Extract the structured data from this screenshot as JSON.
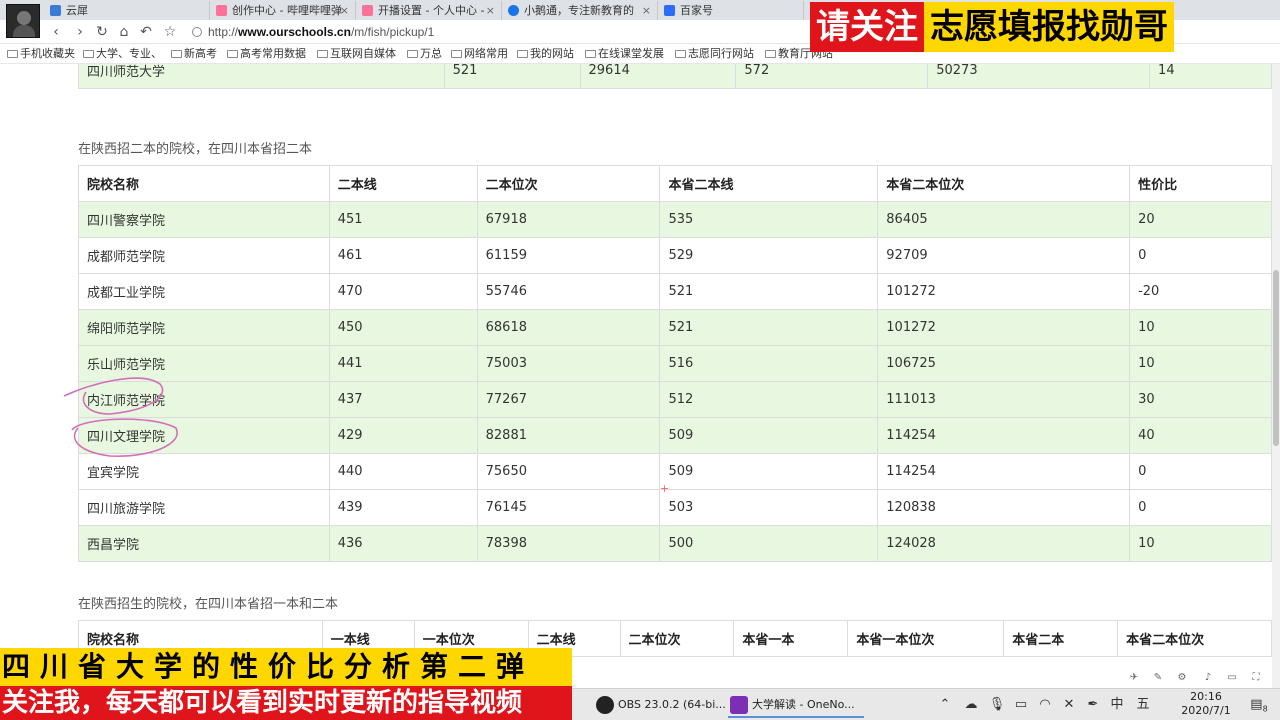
{
  "browser": {
    "tabs": [
      {
        "label": "云犀",
        "color": "#3a7bd5"
      },
      {
        "label": "创作中心 - 哔哩哔哩弹",
        "color": "#fb7299"
      },
      {
        "label": "开播设置 - 个人中心 -",
        "color": "#fb7299"
      },
      {
        "label": "小鹅通，专注新教育的",
        "color": "#1a73e8"
      },
      {
        "label": "百家号",
        "color": "#2d6cf5"
      }
    ],
    "address": {
      "prefix": "http://",
      "domain": "www.ourschools.cn",
      "path": "/m/fish/pickup/1"
    },
    "bookmarks": [
      "手机收藏夹",
      "大学、专业、",
      "新高考",
      "高考常用数据",
      "互联网自媒体",
      "万总",
      "网络常用",
      "我的网站",
      "在线课堂发展",
      "志愿同行网站",
      "教育厅网站"
    ]
  },
  "top_table_row": {
    "cells": [
      "四川师范大学",
      "521",
      "29614",
      "572",
      "50273",
      "14"
    ]
  },
  "section2": {
    "caption": "在陕西招二本的院校，在四川本省招二本",
    "headers": [
      "院校名称",
      "二本线",
      "二本位次",
      "本省二本线",
      "本省二本位次",
      "性价比"
    ],
    "rows": [
      [
        "四川警察学院",
        "451",
        "67918",
        "535",
        "86405",
        "20"
      ],
      [
        "成都师范学院",
        "461",
        "61159",
        "529",
        "92709",
        "0"
      ],
      [
        "成都工业学院",
        "470",
        "55746",
        "521",
        "101272",
        "-20"
      ],
      [
        "绵阳师范学院",
        "450",
        "68618",
        "521",
        "101272",
        "10"
      ],
      [
        "乐山师范学院",
        "441",
        "75003",
        "516",
        "106725",
        "10"
      ],
      [
        "内江师范学院",
        "437",
        "77267",
        "512",
        "111013",
        "30"
      ],
      [
        "四川文理学院",
        "429",
        "82881",
        "509",
        "114254",
        "40"
      ],
      [
        "宜宾学院",
        "440",
        "75650",
        "509",
        "114254",
        "0"
      ],
      [
        "四川旅游学院",
        "439",
        "76145",
        "503",
        "120838",
        "0"
      ],
      [
        "西昌学院",
        "436",
        "78398",
        "500",
        "124028",
        "10"
      ]
    ],
    "highlighted": [
      true,
      false,
      false,
      true,
      true,
      true,
      true,
      false,
      false,
      true
    ]
  },
  "section3": {
    "caption": "在陕西招生的院校，在四川本省招一本和二本",
    "headers": [
      "院校名称",
      "一本线",
      "一本位次",
      "二本线",
      "二本位次",
      "本省一本",
      "本省一本位次",
      "本省二本",
      "本省二本位次"
    ]
  },
  "overlay": {
    "top_red": "请关注",
    "top_yellow": "志愿填报找勋哥",
    "bottom_line1": "四川省大学的性价比分析第二弹",
    "bottom_line2": "关注我，每天都可以看到实时更新的指导视频"
  },
  "taskbar": {
    "apps": [
      {
        "label": "OBS 23.0.2 (64-bi...",
        "color": "#222222"
      },
      {
        "label": "大学解读 - OneNo...",
        "color": "#7b2fb5"
      }
    ],
    "ime": "五",
    "time": "20:16",
    "date": "2020/7/1",
    "notifications": "8"
  }
}
